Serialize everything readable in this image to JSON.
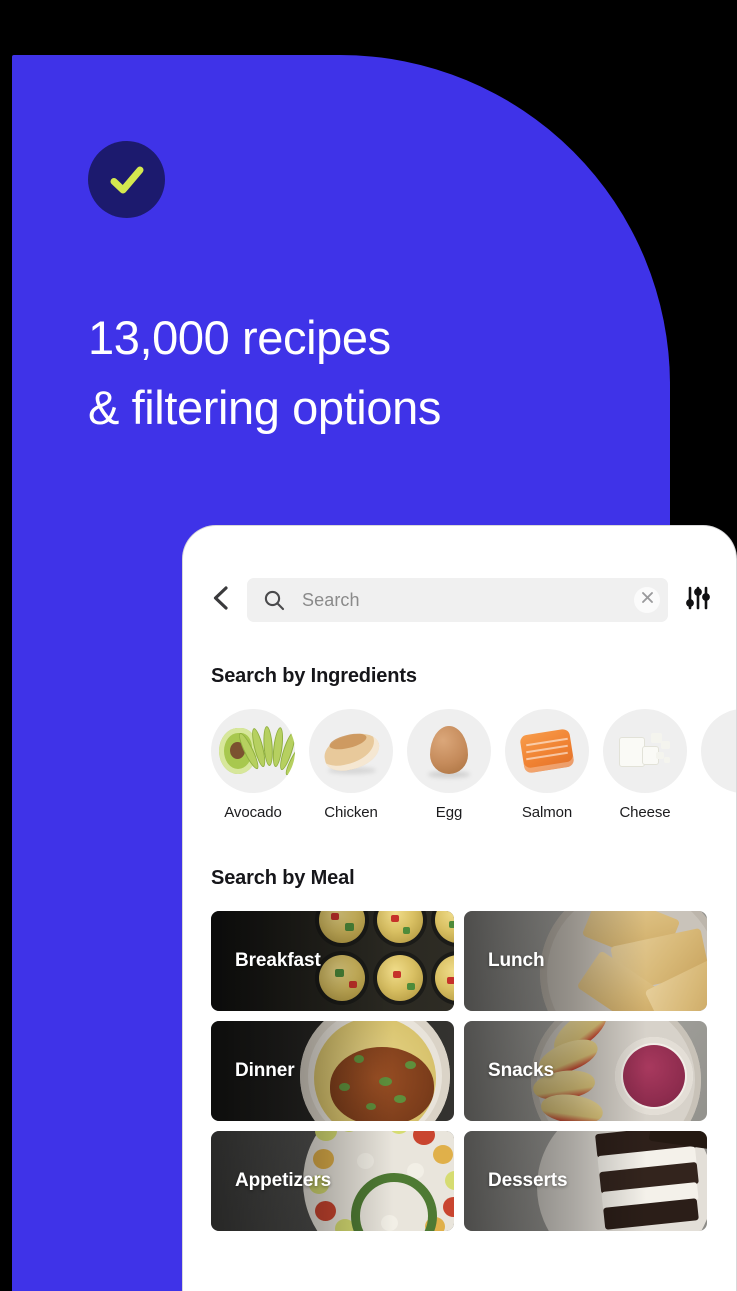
{
  "promo": {
    "badge_icon": "check-icon",
    "headline": "13,000 recipes\n& filtering options",
    "background_color": "#3F33E8",
    "badge_color": "#1C1A6E",
    "check_color": "#D4E84F"
  },
  "app": {
    "topbar": {
      "back_icon": "back-chevron-icon",
      "search_icon": "search-icon",
      "search_value": "",
      "search_placeholder": "Search",
      "clear_icon": "close-icon",
      "filter_icon": "filter-sliders-icon"
    },
    "ingredients_section": {
      "title": "Search by Ingredients",
      "items": [
        {
          "label": "Avocado",
          "icon": "avocado-thumb"
        },
        {
          "label": "Chicken",
          "icon": "chicken-thumb"
        },
        {
          "label": "Egg",
          "icon": "egg-thumb"
        },
        {
          "label": "Salmon",
          "icon": "salmon-thumb"
        },
        {
          "label": "Cheese",
          "icon": "cheese-thumb"
        },
        {
          "label": "",
          "icon": "partial-thumb"
        }
      ]
    },
    "meals_section": {
      "title": "Search by Meal",
      "items": [
        {
          "label": "Breakfast",
          "photo": "egg-muffin-cups"
        },
        {
          "label": "Lunch",
          "photo": "quesadilla-plate"
        },
        {
          "label": "Dinner",
          "photo": "pasta-bolognese-bowl"
        },
        {
          "label": "Snacks",
          "photo": "apple-slices-berry-dip"
        },
        {
          "label": "Appetizers",
          "photo": "antipasto-wreath-platter"
        },
        {
          "label": "Desserts",
          "photo": "chocolate-cake-slice"
        }
      ]
    }
  }
}
